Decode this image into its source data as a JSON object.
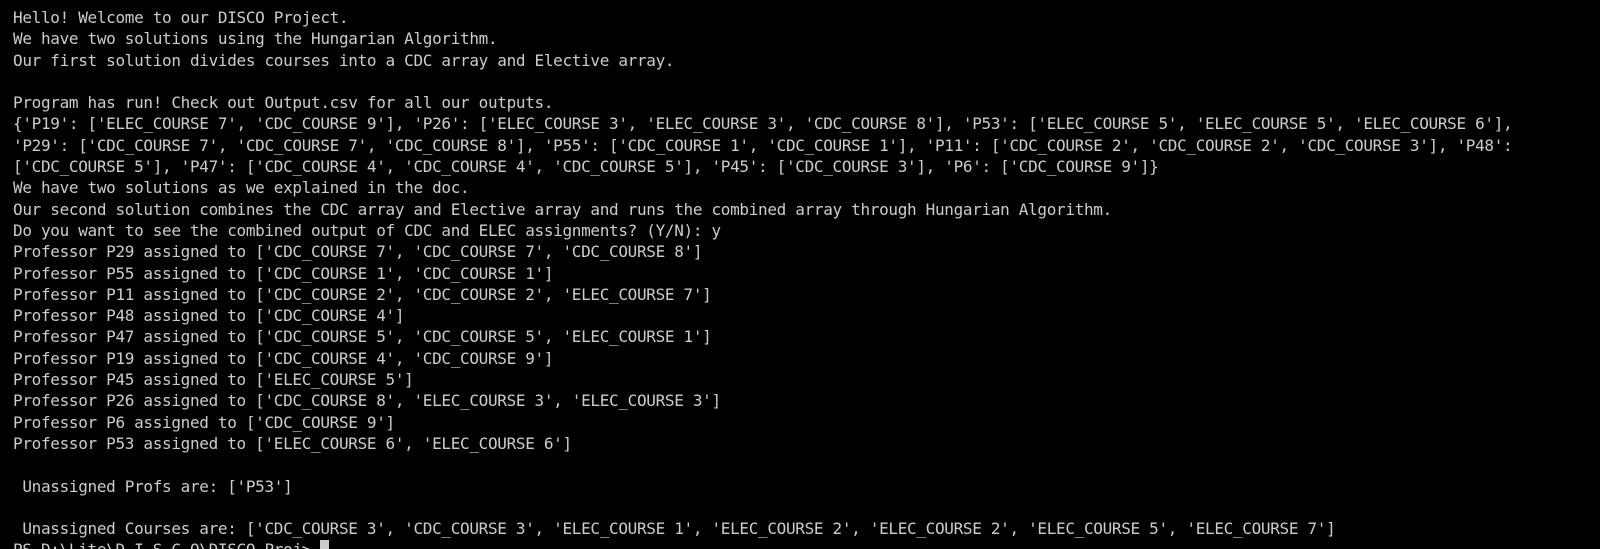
{
  "terminal": {
    "lines": [
      "Hello! Welcome to our DISCO Project.",
      "We have two solutions using the Hungarian Algorithm.",
      "Our first solution divides courses into a CDC array and Elective array.",
      "",
      "Program has run! Check out Output.csv for all our outputs.",
      "{'P19': ['ELEC_COURSE 7', 'CDC_COURSE 9'], 'P26': ['ELEC_COURSE 3', 'ELEC_COURSE 3', 'CDC_COURSE 8'], 'P53': ['ELEC_COURSE 5', 'ELEC_COURSE 5', 'ELEC_COURSE 6'],",
      "'P29': ['CDC_COURSE 7', 'CDC_COURSE 7', 'CDC_COURSE 8'], 'P55': ['CDC_COURSE 1', 'CDC_COURSE 1'], 'P11': ['CDC_COURSE 2', 'CDC_COURSE 2', 'CDC_COURSE 3'], 'P48':",
      "['CDC_COURSE 5'], 'P47': ['CDC_COURSE 4', 'CDC_COURSE 4', 'CDC_COURSE 5'], 'P45': ['CDC_COURSE 3'], 'P6': ['CDC_COURSE 9']}",
      "We have two solutions as we explained in the doc.",
      "Our second solution combines the CDC array and Elective array and runs the combined array through Hungarian Algorithm.",
      "Do you want to see the combined output of CDC and ELEC assignments? (Y/N): y",
      "Professor P29 assigned to ['CDC_COURSE 7', 'CDC_COURSE 7', 'CDC_COURSE 8']",
      "Professor P55 assigned to ['CDC_COURSE 1', 'CDC_COURSE 1']",
      "Professor P11 assigned to ['CDC_COURSE 2', 'CDC_COURSE 2', 'ELEC_COURSE 7']",
      "Professor P48 assigned to ['CDC_COURSE 4']",
      "Professor P47 assigned to ['CDC_COURSE 5', 'CDC_COURSE 5', 'ELEC_COURSE 1']",
      "Professor P19 assigned to ['CDC_COURSE 4', 'CDC_COURSE 9']",
      "Professor P45 assigned to ['ELEC_COURSE 5']",
      "Professor P26 assigned to ['CDC_COURSE 8', 'ELEC_COURSE 3', 'ELEC_COURSE 3']",
      "Professor P6 assigned to ['CDC_COURSE 9']",
      "Professor P53 assigned to ['ELEC_COURSE 6', 'ELEC_COURSE 6']",
      "",
      " Unassigned Profs are: ['P53']",
      "",
      " Unassigned Courses are: ['CDC_COURSE 3', 'CDC_COURSE 3', 'ELEC_COURSE 1', 'ELEC_COURSE 2', 'ELEC_COURSE 2', 'ELEC_COURSE 5', 'ELEC_COURSE 7']"
    ],
    "prompt": "PS D:\\Lite\\D.I.S.C.O\\DISCO_Proj> ",
    "colors": {
      "background": "#000000",
      "text": "#cccccc"
    }
  }
}
